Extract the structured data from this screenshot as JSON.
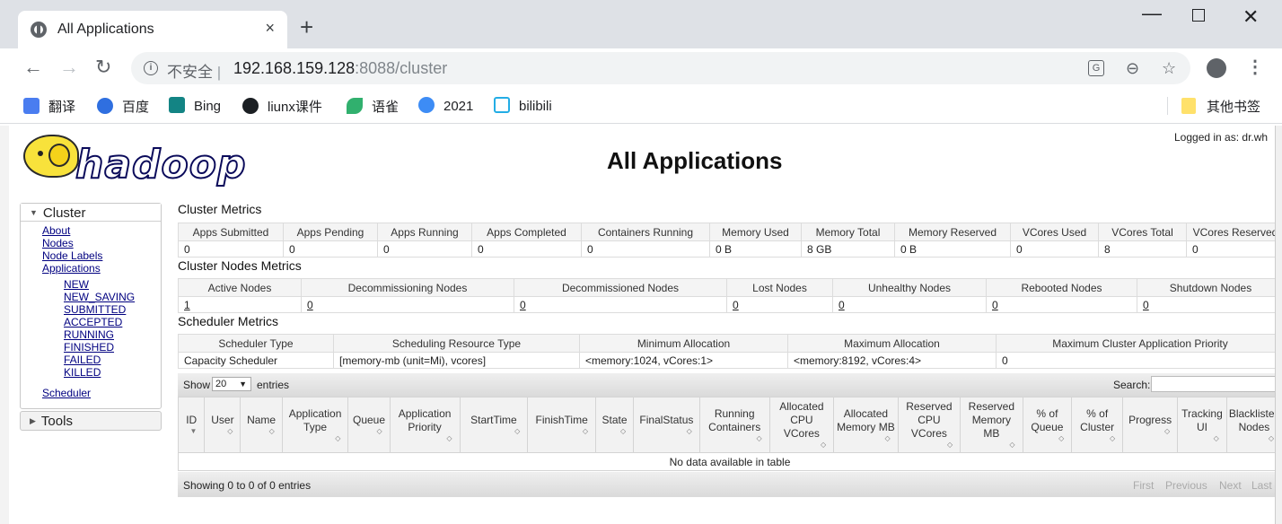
{
  "browser": {
    "tab_title": "All Applications",
    "tab_close": "×",
    "new_tab": "+",
    "insecure_label": "不安全",
    "url_host": "192.168.159.128",
    "url_rest": ":8088/cluster",
    "bookmarks": [
      "翻译",
      "百度",
      "Bing",
      "liunx课件",
      "语雀",
      "2021",
      "bilibili"
    ],
    "other_bookmarks": "其他书签"
  },
  "header": {
    "logo_text": "hadoop",
    "title": "All Applications",
    "logged_in": "Logged in as: dr.wh"
  },
  "nav": {
    "cluster": "Cluster",
    "links": [
      "About",
      "Nodes",
      "Node Labels",
      "Applications"
    ],
    "app_states": [
      "NEW",
      "NEW_SAVING",
      "SUBMITTED",
      "ACCEPTED",
      "RUNNING",
      "FINISHED",
      "FAILED",
      "KILLED"
    ],
    "scheduler": "Scheduler",
    "tools": "Tools"
  },
  "cluster_metrics": {
    "title": "Cluster Metrics",
    "headers": [
      "Apps Submitted",
      "Apps Pending",
      "Apps Running",
      "Apps Completed",
      "Containers Running",
      "Memory Used",
      "Memory Total",
      "Memory Reserved",
      "VCores Used",
      "VCores Total",
      "VCores Reserved"
    ],
    "values": [
      "0",
      "0",
      "0",
      "0",
      "0",
      "0 B",
      "8 GB",
      "0 B",
      "0",
      "8",
      "0"
    ]
  },
  "node_metrics": {
    "title": "Cluster Nodes Metrics",
    "headers": [
      "Active Nodes",
      "Decommissioning Nodes",
      "Decommissioned Nodes",
      "Lost Nodes",
      "Unhealthy Nodes",
      "Rebooted Nodes",
      "Shutdown Nodes"
    ],
    "values": [
      "1",
      "0",
      "0",
      "0",
      "0",
      "0",
      "0"
    ]
  },
  "scheduler_metrics": {
    "title": "Scheduler Metrics",
    "headers": [
      "Scheduler Type",
      "Scheduling Resource Type",
      "Minimum Allocation",
      "Maximum Allocation",
      "Maximum Cluster Application Priority"
    ],
    "values": [
      "Capacity Scheduler",
      "[memory-mb (unit=Mi), vcores]",
      "<memory:1024, vCores:1>",
      "<memory:8192, vCores:4>",
      "0"
    ]
  },
  "apps_table": {
    "show_label": "Show",
    "page_size": "20",
    "entries_label": "entries",
    "search_label": "Search:",
    "columns": [
      "ID",
      "User",
      "Name",
      "Application Type",
      "Queue",
      "Application Priority",
      "StartTime",
      "FinishTime",
      "State",
      "FinalStatus",
      "Running Containers",
      "Allocated CPU VCores",
      "Allocated Memory MB",
      "Reserved CPU VCores",
      "Reserved Memory MB",
      "% of Queue",
      "% of Cluster",
      "Progress",
      "Tracking UI",
      "Blacklisted Nodes"
    ],
    "empty_message": "No data available in table",
    "showing": "Showing 0 to 0 of 0 entries",
    "pager": [
      "First",
      "Previous",
      "Next",
      "Last"
    ]
  }
}
